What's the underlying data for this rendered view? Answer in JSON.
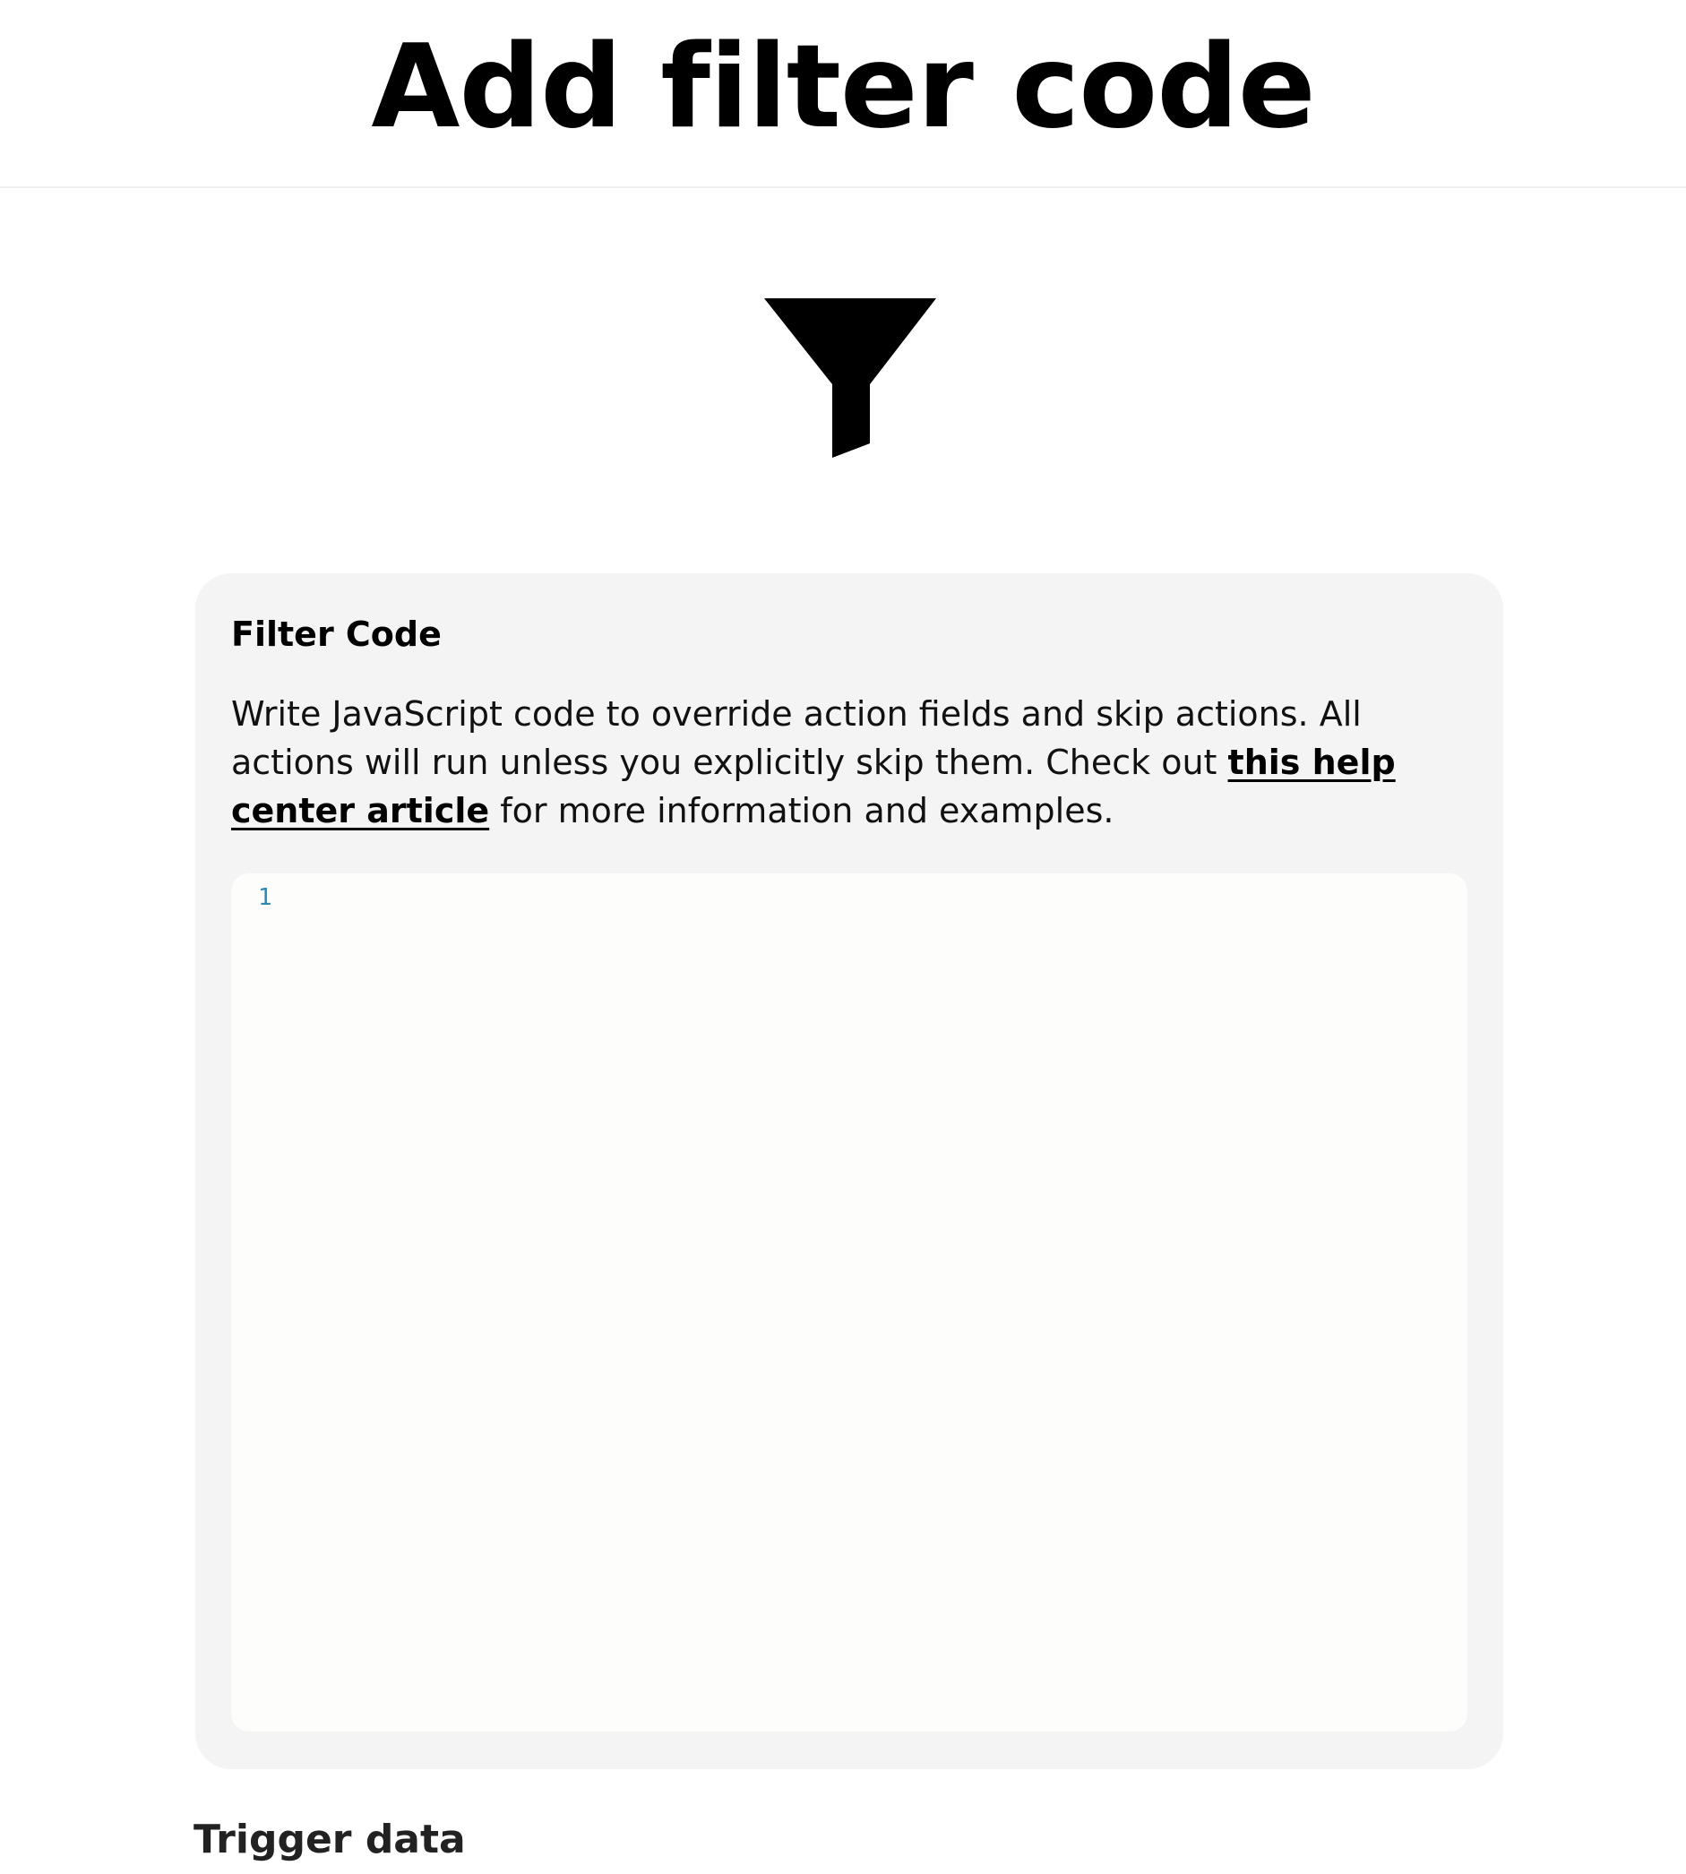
{
  "header": {
    "title": "Add filter code"
  },
  "icon": {
    "name": "funnel-icon",
    "color": "#000000"
  },
  "filter_card": {
    "title": "Filter Code",
    "description_before_link": "Write JavaScript code to override action fields and skip actions. All actions will run unless you explicitly skip them. Check out ",
    "link_text": "this help center article",
    "description_after_link": " for more information and examples.",
    "editor": {
      "line_numbers": [
        "1"
      ],
      "content": ""
    },
    "colors": {
      "card_background": "#f4f4f4",
      "editor_background": "#fdfdfb",
      "line_number": "#2b8ab5"
    }
  },
  "trigger_section": {
    "title": "Trigger data"
  }
}
